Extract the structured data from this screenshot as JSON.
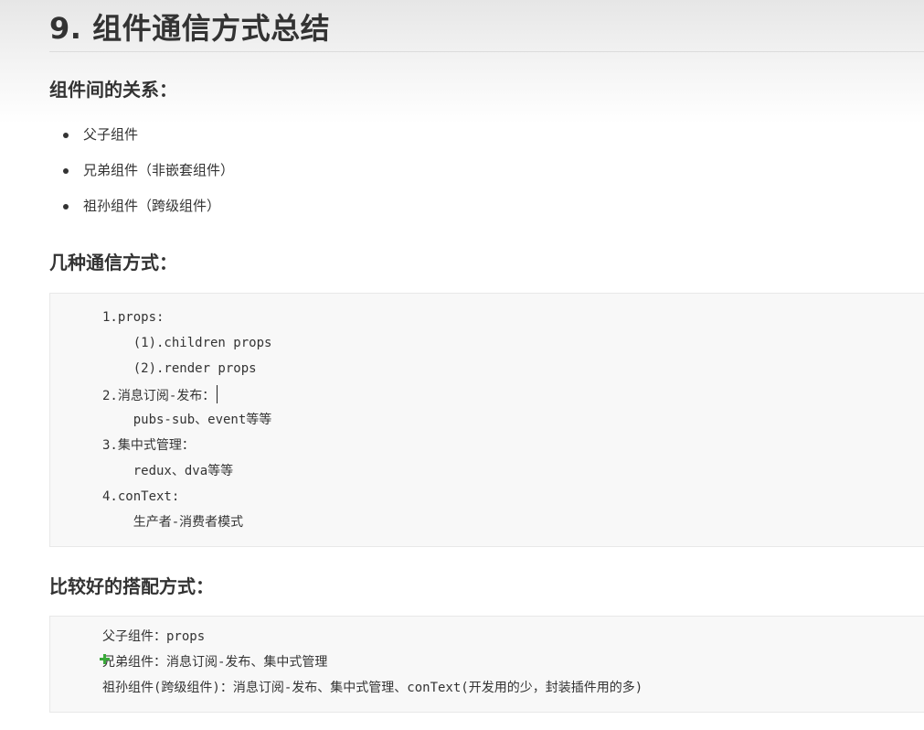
{
  "doc": {
    "title": "9. 组件通信方式总结"
  },
  "relations": {
    "heading": "组件间的关系：",
    "items": [
      "父子组件",
      "兄弟组件（非嵌套组件）",
      "祖孙组件（跨级组件）"
    ]
  },
  "methods": {
    "heading": "几种通信方式：",
    "lines": [
      "1.props:",
      "    (1).children props",
      "    (2).render props",
      "2.消息订阅-发布：",
      "    pubs-sub、event等等",
      "3.集中式管理：",
      "    redux、dva等等",
      "4.conText:",
      "    生产者-消费者模式"
    ]
  },
  "best": {
    "heading": "比较好的搭配方式：",
    "lines": [
      "父子组件：props",
      "兄弟组件：消息订阅-发布、集中式管理",
      "祖孙组件(跨级组件)：消息订阅-发布、集中式管理、conText(开发用的少，封装插件用的多)"
    ]
  },
  "colors": {
    "text": "#333333",
    "code_bg": "#f8f8f8",
    "code_border": "#e8e8e8",
    "plus_marker": "#3aa83a"
  }
}
